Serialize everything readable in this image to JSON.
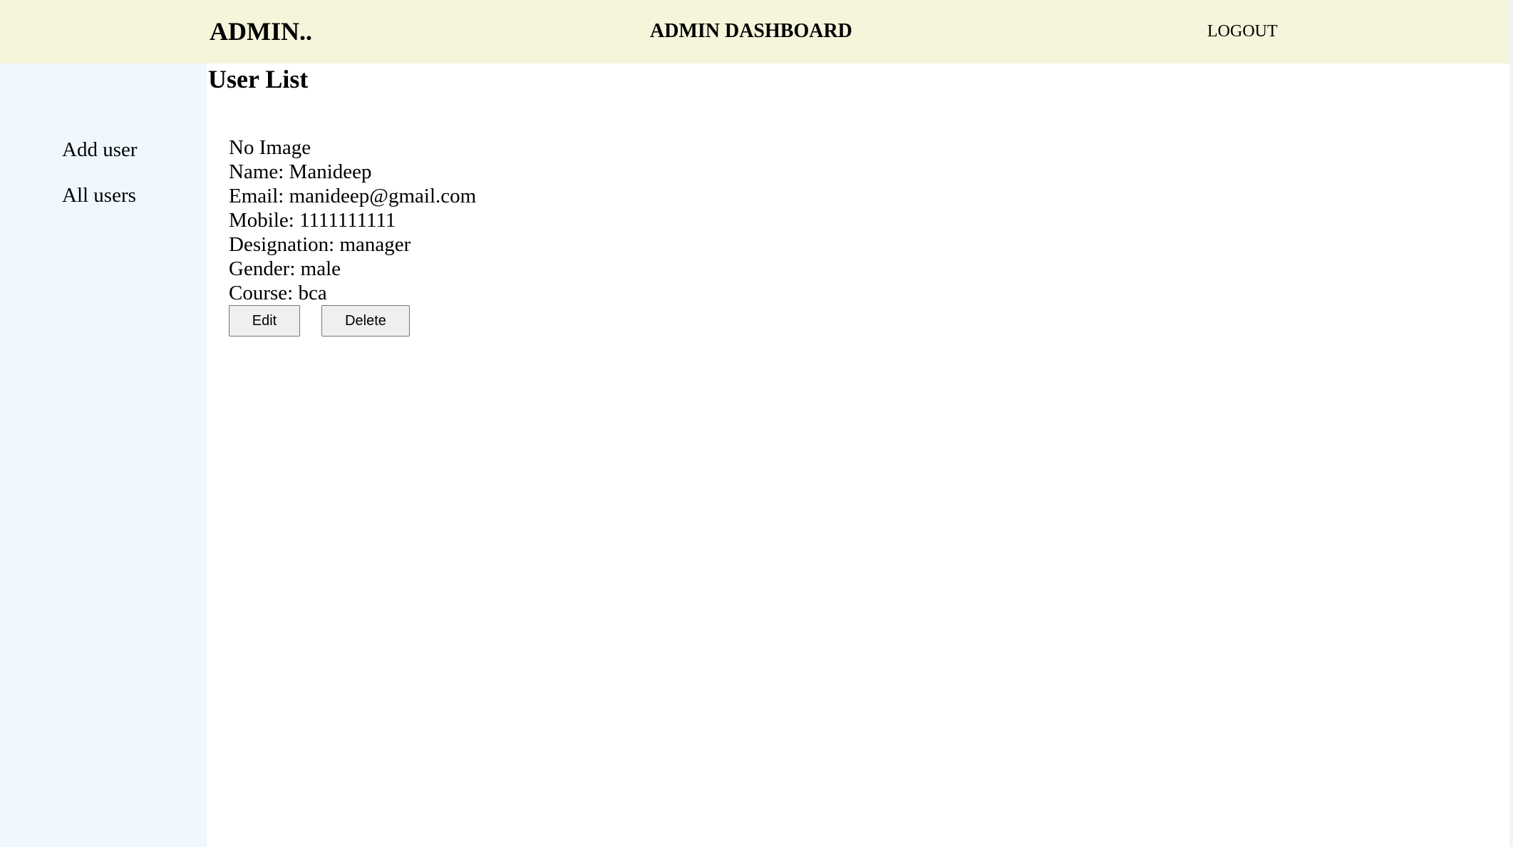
{
  "header": {
    "brand": "ADMIN..",
    "title": "ADMIN DASHBOARD",
    "logout_label": "LOGOUT"
  },
  "sidebar": {
    "items": [
      {
        "label": "Add user"
      },
      {
        "label": "All users"
      }
    ]
  },
  "main": {
    "title": "User List",
    "users": [
      {
        "image_text": "No Image",
        "name": "Name: Manideep",
        "email": "Email: manideep@gmail.com",
        "mobile": "Mobile: 1111111111",
        "designation": "Designation: manager",
        "gender": "Gender: male",
        "course": "Course: bca",
        "edit_label": "Edit",
        "delete_label": "Delete"
      }
    ]
  },
  "colors": {
    "header_bg": "#f5f5dc",
    "sidebar_bg": "#f0f8ff",
    "button_bg": "#efefef"
  }
}
